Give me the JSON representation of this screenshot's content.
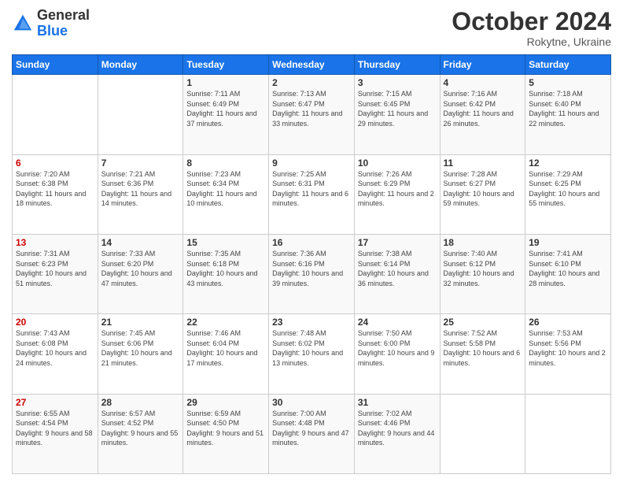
{
  "header": {
    "logo_line1": "General",
    "logo_line2": "Blue",
    "title": "October 2024",
    "subtitle": "Rokytne, Ukraine"
  },
  "weekdays": [
    "Sunday",
    "Monday",
    "Tuesday",
    "Wednesday",
    "Thursday",
    "Friday",
    "Saturday"
  ],
  "weeks": [
    [
      {
        "day": "",
        "sunrise": "",
        "sunset": "",
        "daylight": ""
      },
      {
        "day": "",
        "sunrise": "",
        "sunset": "",
        "daylight": ""
      },
      {
        "day": "1",
        "sunrise": "Sunrise: 7:11 AM",
        "sunset": "Sunset: 6:49 PM",
        "daylight": "Daylight: 11 hours and 37 minutes."
      },
      {
        "day": "2",
        "sunrise": "Sunrise: 7:13 AM",
        "sunset": "Sunset: 6:47 PM",
        "daylight": "Daylight: 11 hours and 33 minutes."
      },
      {
        "day": "3",
        "sunrise": "Sunrise: 7:15 AM",
        "sunset": "Sunset: 6:45 PM",
        "daylight": "Daylight: 11 hours and 29 minutes."
      },
      {
        "day": "4",
        "sunrise": "Sunrise: 7:16 AM",
        "sunset": "Sunset: 6:42 PM",
        "daylight": "Daylight: 11 hours and 26 minutes."
      },
      {
        "day": "5",
        "sunrise": "Sunrise: 7:18 AM",
        "sunset": "Sunset: 6:40 PM",
        "daylight": "Daylight: 11 hours and 22 minutes."
      }
    ],
    [
      {
        "day": "6",
        "sunrise": "Sunrise: 7:20 AM",
        "sunset": "Sunset: 6:38 PM",
        "daylight": "Daylight: 11 hours and 18 minutes."
      },
      {
        "day": "7",
        "sunrise": "Sunrise: 7:21 AM",
        "sunset": "Sunset: 6:36 PM",
        "daylight": "Daylight: 11 hours and 14 minutes."
      },
      {
        "day": "8",
        "sunrise": "Sunrise: 7:23 AM",
        "sunset": "Sunset: 6:34 PM",
        "daylight": "Daylight: 11 hours and 10 minutes."
      },
      {
        "day": "9",
        "sunrise": "Sunrise: 7:25 AM",
        "sunset": "Sunset: 6:31 PM",
        "daylight": "Daylight: 11 hours and 6 minutes."
      },
      {
        "day": "10",
        "sunrise": "Sunrise: 7:26 AM",
        "sunset": "Sunset: 6:29 PM",
        "daylight": "Daylight: 11 hours and 2 minutes."
      },
      {
        "day": "11",
        "sunrise": "Sunrise: 7:28 AM",
        "sunset": "Sunset: 6:27 PM",
        "daylight": "Daylight: 10 hours and 59 minutes."
      },
      {
        "day": "12",
        "sunrise": "Sunrise: 7:29 AM",
        "sunset": "Sunset: 6:25 PM",
        "daylight": "Daylight: 10 hours and 55 minutes."
      }
    ],
    [
      {
        "day": "13",
        "sunrise": "Sunrise: 7:31 AM",
        "sunset": "Sunset: 6:23 PM",
        "daylight": "Daylight: 10 hours and 51 minutes."
      },
      {
        "day": "14",
        "sunrise": "Sunrise: 7:33 AM",
        "sunset": "Sunset: 6:20 PM",
        "daylight": "Daylight: 10 hours and 47 minutes."
      },
      {
        "day": "15",
        "sunrise": "Sunrise: 7:35 AM",
        "sunset": "Sunset: 6:18 PM",
        "daylight": "Daylight: 10 hours and 43 minutes."
      },
      {
        "day": "16",
        "sunrise": "Sunrise: 7:36 AM",
        "sunset": "Sunset: 6:16 PM",
        "daylight": "Daylight: 10 hours and 39 minutes."
      },
      {
        "day": "17",
        "sunrise": "Sunrise: 7:38 AM",
        "sunset": "Sunset: 6:14 PM",
        "daylight": "Daylight: 10 hours and 36 minutes."
      },
      {
        "day": "18",
        "sunrise": "Sunrise: 7:40 AM",
        "sunset": "Sunset: 6:12 PM",
        "daylight": "Daylight: 10 hours and 32 minutes."
      },
      {
        "day": "19",
        "sunrise": "Sunrise: 7:41 AM",
        "sunset": "Sunset: 6:10 PM",
        "daylight": "Daylight: 10 hours and 28 minutes."
      }
    ],
    [
      {
        "day": "20",
        "sunrise": "Sunrise: 7:43 AM",
        "sunset": "Sunset: 6:08 PM",
        "daylight": "Daylight: 10 hours and 24 minutes."
      },
      {
        "day": "21",
        "sunrise": "Sunrise: 7:45 AM",
        "sunset": "Sunset: 6:06 PM",
        "daylight": "Daylight: 10 hours and 21 minutes."
      },
      {
        "day": "22",
        "sunrise": "Sunrise: 7:46 AM",
        "sunset": "Sunset: 6:04 PM",
        "daylight": "Daylight: 10 hours and 17 minutes."
      },
      {
        "day": "23",
        "sunrise": "Sunrise: 7:48 AM",
        "sunset": "Sunset: 6:02 PM",
        "daylight": "Daylight: 10 hours and 13 minutes."
      },
      {
        "day": "24",
        "sunrise": "Sunrise: 7:50 AM",
        "sunset": "Sunset: 6:00 PM",
        "daylight": "Daylight: 10 hours and 9 minutes."
      },
      {
        "day": "25",
        "sunrise": "Sunrise: 7:52 AM",
        "sunset": "Sunset: 5:58 PM",
        "daylight": "Daylight: 10 hours and 6 minutes."
      },
      {
        "day": "26",
        "sunrise": "Sunrise: 7:53 AM",
        "sunset": "Sunset: 5:56 PM",
        "daylight": "Daylight: 10 hours and 2 minutes."
      }
    ],
    [
      {
        "day": "27",
        "sunrise": "Sunrise: 6:55 AM",
        "sunset": "Sunset: 4:54 PM",
        "daylight": "Daylight: 9 hours and 58 minutes."
      },
      {
        "day": "28",
        "sunrise": "Sunrise: 6:57 AM",
        "sunset": "Sunset: 4:52 PM",
        "daylight": "Daylight: 9 hours and 55 minutes."
      },
      {
        "day": "29",
        "sunrise": "Sunrise: 6:59 AM",
        "sunset": "Sunset: 4:50 PM",
        "daylight": "Daylight: 9 hours and 51 minutes."
      },
      {
        "day": "30",
        "sunrise": "Sunrise: 7:00 AM",
        "sunset": "Sunset: 4:48 PM",
        "daylight": "Daylight: 9 hours and 47 minutes."
      },
      {
        "day": "31",
        "sunrise": "Sunrise: 7:02 AM",
        "sunset": "Sunset: 4:46 PM",
        "daylight": "Daylight: 9 hours and 44 minutes."
      },
      {
        "day": "",
        "sunrise": "",
        "sunset": "",
        "daylight": ""
      },
      {
        "day": "",
        "sunrise": "",
        "sunset": "",
        "daylight": ""
      }
    ]
  ]
}
